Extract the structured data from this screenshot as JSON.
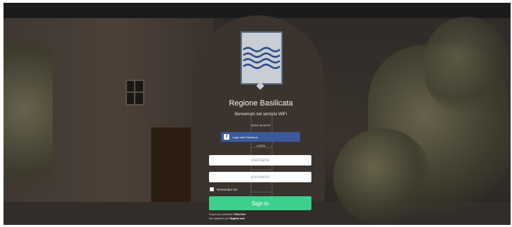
{
  "brand": {
    "name": "Regione Basilicata",
    "welcome": "Benvenuto nel servizio WiFi"
  },
  "social": {
    "heading": "SIGN IN WITH",
    "facebook_label": "Login with Facebook",
    "facebook_icon": "f"
  },
  "login": {
    "heading": "LOGIN",
    "username_placeholder": "username",
    "password_placeholder": "password",
    "remember_label": "Remember me",
    "signin_label": "Sign in"
  },
  "footer": {
    "forgot_text": "Forgot your password?",
    "forgot_link": "Click here",
    "register_text": "Not registered yet?",
    "register_link": "Register now"
  },
  "colors": {
    "facebook": "#3b5998",
    "signin": "#3ecf8e",
    "logo_fill": "#c9ced6",
    "logo_waves": "#2f4f86"
  }
}
